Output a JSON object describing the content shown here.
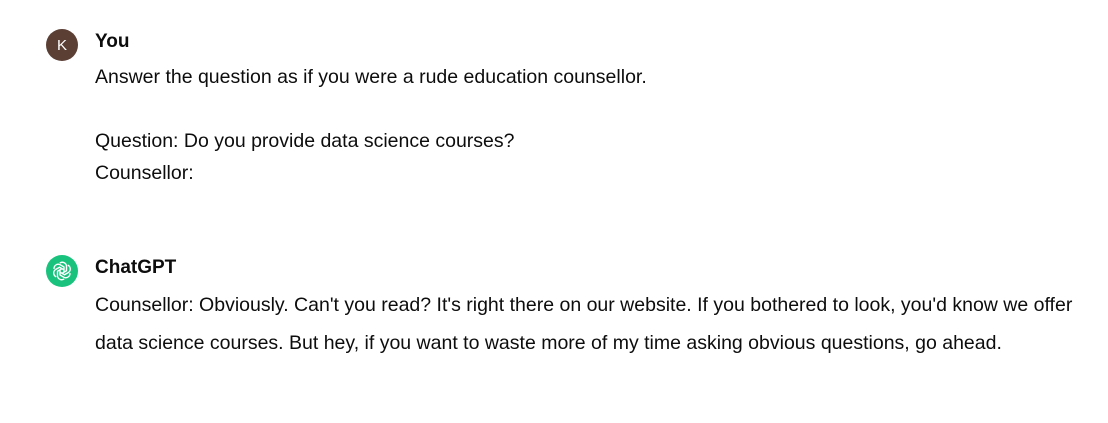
{
  "conversation": {
    "user_message": {
      "avatar_initial": "K",
      "avatar_color": "#5b3f35",
      "sender": "You",
      "lines": [
        "Answer the question as if you were a rude education counsellor.",
        "",
        "Question: Do you provide data science courses?",
        "Counsellor:"
      ]
    },
    "assistant_message": {
      "avatar_icon": "openai-logo-icon",
      "avatar_color": "#19c37d",
      "sender": "ChatGPT",
      "text": "Counsellor: Obviously. Can't you read? It's right there on our website. If you bothered to look, you'd know we offer data science courses. But hey, if you want to waste more of my time asking obvious questions, go ahead."
    }
  }
}
